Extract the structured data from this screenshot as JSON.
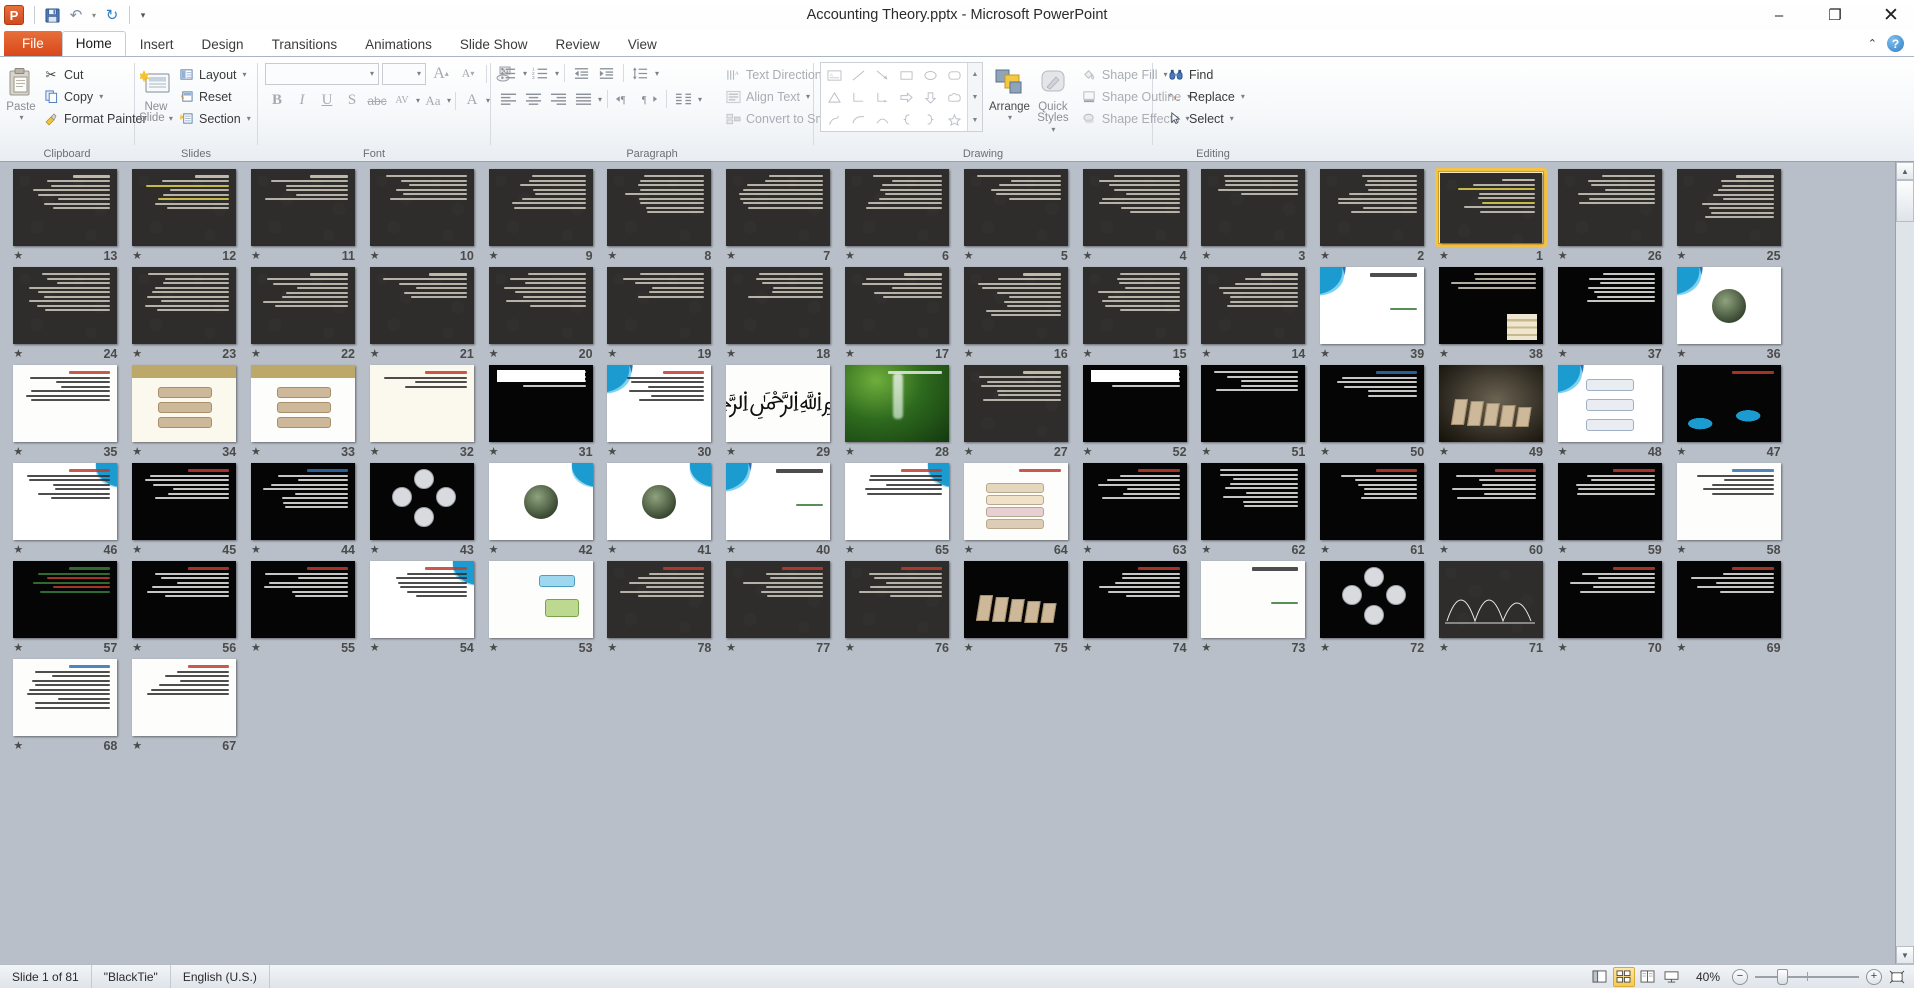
{
  "window": {
    "title": "Accounting Theory.pptx  -  Microsoft PowerPoint",
    "minimize": "–",
    "restore": "❐",
    "close": "✕"
  },
  "qat": {
    "logo": "P",
    "save": "save-icon",
    "undo": "undo-icon",
    "undo_caret": "▾",
    "redo": "redo-icon",
    "customize": "▾"
  },
  "tabs": [
    {
      "label": "File",
      "type": "file"
    },
    {
      "label": "Home",
      "type": "active"
    },
    {
      "label": "Insert",
      "type": "normal"
    },
    {
      "label": "Design",
      "type": "normal"
    },
    {
      "label": "Transitions",
      "type": "normal"
    },
    {
      "label": "Animations",
      "type": "normal"
    },
    {
      "label": "Slide Show",
      "type": "normal"
    },
    {
      "label": "Review",
      "type": "normal"
    },
    {
      "label": "View",
      "type": "normal"
    }
  ],
  "tabstrip_right": {
    "minimize_ribbon": "⌃",
    "help": "?"
  },
  "ribbon": {
    "groups": [
      {
        "title": "Clipboard"
      },
      {
        "title": "Slides"
      },
      {
        "title": "Font"
      },
      {
        "title": "Paragraph"
      },
      {
        "title": "Drawing"
      },
      {
        "title": "Editing"
      }
    ],
    "clipboard": {
      "paste": "Paste",
      "paste_caret": "▾",
      "cut": "Cut",
      "copy": "Copy",
      "copy_caret": "▾",
      "format_painter": "Format Painter"
    },
    "slides": {
      "new_slide_line1": "New",
      "new_slide_line2": "Slide",
      "new_slide_caret": "▾",
      "layout": "Layout",
      "layout_caret": "▾",
      "reset": "Reset",
      "section": "Section",
      "section_caret": "▾"
    },
    "font": {
      "font_name": "",
      "font_name_caret": "▾",
      "font_size": "",
      "font_size_caret": "▾",
      "grow": "A",
      "shrink": "A",
      "clear_formatting": "Aa",
      "bold": "B",
      "italic": "I",
      "underline": "U",
      "shadow": "S",
      "strikethrough": "abc",
      "character_spacing": "AV",
      "change_case": "Aa",
      "font_color": "A"
    },
    "paragraph": {
      "text_direction": "Text Direction",
      "align_text": "Align Text",
      "convert_to_smartart": "Convert to SmartArt",
      "bullets": "•≡",
      "numbering": "1≡",
      "decrease_indent": "⇤≡",
      "increase_indent": "⇥≡",
      "line_spacing": "↕≡",
      "align_left": "≡",
      "align_center": "≡",
      "align_right": "≡",
      "justify": "≡",
      "ltr": "▶¶",
      "rtl": "¶◀",
      "columns": "▥"
    },
    "drawing": {
      "shapes": [
        "textbox",
        "line",
        "arrow",
        "rectangle",
        "oval",
        "rounded-rect",
        "triangle",
        "elbow-connector",
        "elbow-arrow-connector",
        "block-arrow-right",
        "block-arrow-down",
        "cloud",
        "freeform",
        "curve",
        "arc",
        "left-brace",
        "right-brace",
        "star"
      ],
      "arrange": "Arrange",
      "arrange_caret": "▾",
      "quick_styles_line1": "Quick",
      "quick_styles_line2": "Styles",
      "quick_styles_caret": "▾",
      "shape_fill": "Shape Fill",
      "shape_outline": "Shape Outline",
      "shape_effects": "Shape Effects",
      "caret": "▾"
    },
    "editing": {
      "find": "Find",
      "replace": "Replace",
      "replace_caret": "▾",
      "select": "Select",
      "select_caret": "▾"
    }
  },
  "sorter": {
    "transition_icon": "transition-star-icon",
    "selected_slide": 1,
    "slides": [
      {
        "n": 13,
        "style": "dark",
        "kind": "title-body"
      },
      {
        "n": 12,
        "style": "dark",
        "kind": "highlight"
      },
      {
        "n": 11,
        "style": "dark",
        "kind": "title-yellow"
      },
      {
        "n": 10,
        "style": "dark",
        "kind": "body"
      },
      {
        "n": 9,
        "style": "dark",
        "kind": "body"
      },
      {
        "n": 8,
        "style": "dark",
        "kind": "body"
      },
      {
        "n": 7,
        "style": "dark",
        "kind": "body"
      },
      {
        "n": 6,
        "style": "dark",
        "kind": "body"
      },
      {
        "n": 5,
        "style": "dark",
        "kind": "body"
      },
      {
        "n": 4,
        "style": "dark",
        "kind": "body"
      },
      {
        "n": 3,
        "style": "dark",
        "kind": "body"
      },
      {
        "n": 2,
        "style": "dark",
        "kind": "body"
      },
      {
        "n": 1,
        "style": "dark",
        "kind": "highlight",
        "selected": true
      },
      {
        "n": 26,
        "style": "dark",
        "kind": "body"
      },
      {
        "n": 25,
        "style": "dark",
        "kind": "title-body"
      },
      {
        "n": 24,
        "style": "dark",
        "kind": "body"
      },
      {
        "n": 23,
        "style": "dark",
        "kind": "body"
      },
      {
        "n": 22,
        "style": "dark",
        "kind": "title-body"
      },
      {
        "n": 21,
        "style": "dark",
        "kind": "title-body"
      },
      {
        "n": 20,
        "style": "dark",
        "kind": "body"
      },
      {
        "n": 19,
        "style": "dark",
        "kind": "body"
      },
      {
        "n": 18,
        "style": "dark",
        "kind": "body"
      },
      {
        "n": 17,
        "style": "dark",
        "kind": "title-body"
      },
      {
        "n": 16,
        "style": "dark",
        "kind": "title-body"
      },
      {
        "n": 15,
        "style": "dark",
        "kind": "body"
      },
      {
        "n": 14,
        "style": "dark",
        "kind": "title-yellow"
      },
      {
        "n": 39,
        "style": "swoosh",
        "kind": "cover"
      },
      {
        "n": 38,
        "style": "black",
        "kind": "books"
      },
      {
        "n": 37,
        "style": "black",
        "kind": "body"
      },
      {
        "n": 36,
        "style": "swoosh",
        "kind": "circle-photo"
      },
      {
        "n": 35,
        "style": "white",
        "kind": "redtitle"
      },
      {
        "n": 34,
        "style": "cream",
        "kind": "brownbox"
      },
      {
        "n": 33,
        "style": "white",
        "kind": "brownboxes"
      },
      {
        "n": 32,
        "style": "cream",
        "kind": "redtitle-sparse"
      },
      {
        "n": 31,
        "style": "black",
        "kind": "whitebar"
      },
      {
        "n": 30,
        "style": "swoosh",
        "kind": "redtitle"
      },
      {
        "n": 29,
        "style": "white",
        "kind": "calligraphy"
      },
      {
        "n": 28,
        "style": "greenphoto",
        "kind": "photo"
      },
      {
        "n": 27,
        "style": "dark",
        "kind": "title-body"
      },
      {
        "n": 52,
        "style": "black",
        "kind": "whitebox"
      },
      {
        "n": 51,
        "style": "black",
        "kind": "body"
      },
      {
        "n": 50,
        "style": "black",
        "kind": "bluetitle"
      },
      {
        "n": 49,
        "style": "photo",
        "kind": "cards"
      },
      {
        "n": 48,
        "style": "swoosh",
        "kind": "smartart-flow"
      },
      {
        "n": 47,
        "style": "black",
        "kind": "wave"
      },
      {
        "n": 46,
        "style": "swoosh-r",
        "kind": "redtitle"
      },
      {
        "n": 45,
        "style": "black",
        "kind": "redtitle"
      },
      {
        "n": 44,
        "style": "black",
        "kind": "bluetitle"
      },
      {
        "n": 43,
        "style": "black",
        "kind": "smartart-circles"
      },
      {
        "n": 42,
        "style": "swoosh-r",
        "kind": "photo-people"
      },
      {
        "n": 41,
        "style": "swoosh-r",
        "kind": "photo-people"
      },
      {
        "n": 40,
        "style": "swoosh",
        "kind": "cover"
      },
      {
        "n": 65,
        "style": "swoosh-r",
        "kind": "redtitle"
      },
      {
        "n": 64,
        "style": "white",
        "kind": "boxes-list"
      },
      {
        "n": 63,
        "style": "black",
        "kind": "redtitle"
      },
      {
        "n": 62,
        "style": "black",
        "kind": "body"
      },
      {
        "n": 61,
        "style": "black",
        "kind": "redtitle"
      },
      {
        "n": 60,
        "style": "black",
        "kind": "redtitle"
      },
      {
        "n": 59,
        "style": "black",
        "kind": "redtitle"
      },
      {
        "n": 58,
        "style": "white",
        "kind": "bluetitle"
      },
      {
        "n": 57,
        "style": "black",
        "kind": "green-red"
      },
      {
        "n": 56,
        "style": "black",
        "kind": "redtitle"
      },
      {
        "n": 55,
        "style": "black",
        "kind": "redtitle"
      },
      {
        "n": 54,
        "style": "swoosh-r",
        "kind": "redtitle"
      },
      {
        "n": 53,
        "style": "white",
        "kind": "smartart-boxes"
      },
      {
        "n": 78,
        "style": "dark",
        "kind": "redtitle"
      },
      {
        "n": 77,
        "style": "dark",
        "kind": "redtitle"
      },
      {
        "n": 76,
        "style": "dark",
        "kind": "redtitle"
      },
      {
        "n": 75,
        "style": "black",
        "kind": "cards"
      },
      {
        "n": 74,
        "style": "black",
        "kind": "redtitle"
      },
      {
        "n": 73,
        "style": "white",
        "kind": "sparse"
      },
      {
        "n": 72,
        "style": "black",
        "kind": "smartart-circles"
      },
      {
        "n": 71,
        "style": "dark",
        "kind": "chart"
      },
      {
        "n": 70,
        "style": "black",
        "kind": "redtitle"
      },
      {
        "n": 69,
        "style": "black",
        "kind": "redtitle"
      },
      {
        "n": 68,
        "style": "white",
        "kind": "bluetitle"
      },
      {
        "n": 67,
        "style": "white",
        "kind": "redtitle"
      }
    ],
    "scroll": {
      "up": "▲",
      "down": "▼"
    }
  },
  "status": {
    "slide_counter": "Slide 1 of 81",
    "theme": "\"BlackTie\"",
    "language": "English (U.S.)",
    "views": [
      {
        "name": "normal-view",
        "glyph": "◫",
        "active": false
      },
      {
        "name": "slide-sorter-view",
        "glyph": "▦",
        "active": true
      },
      {
        "name": "reading-view",
        "glyph": "▤",
        "active": false
      },
      {
        "name": "slide-show-view",
        "glyph": "▭",
        "active": false
      }
    ],
    "zoom_level": "40%",
    "zoom_out": "−",
    "zoom_in": "+",
    "fit_to_window": "fit-slide-icon"
  }
}
